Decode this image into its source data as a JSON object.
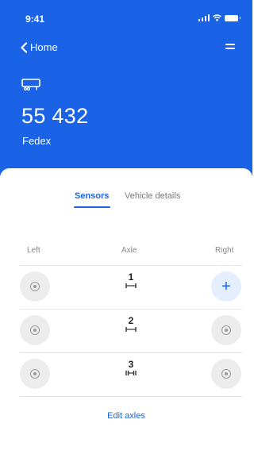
{
  "status_bar": {
    "time": "9:41",
    "icons": [
      "signal-icon",
      "wifi-icon",
      "battery-icon"
    ]
  },
  "nav": {
    "back_label": "Home",
    "back_icon": "chevron-left-icon",
    "menu_icon": "menu-icon"
  },
  "vehicle": {
    "icon": "truck-icon",
    "number": "55 432",
    "company": "Fedex"
  },
  "tabs": [
    {
      "label": "Sensors",
      "active": true
    },
    {
      "label": "Vehicle details",
      "active": false
    }
  ],
  "columns": {
    "left": "Left",
    "axle": "Axle",
    "right": "Right"
  },
  "axles": [
    {
      "number": "1",
      "left": "sensor-icon",
      "right": "add-icon"
    },
    {
      "number": "2",
      "left": "sensor-icon",
      "right": "sensor-icon"
    },
    {
      "number": "3",
      "left": "sensor-icon",
      "right": "sensor-icon"
    }
  ],
  "actions": {
    "edit_axles": "Edit axles"
  },
  "colors": {
    "primary": "#1a63e6",
    "sensor_bg": "#ececec",
    "add_bg": "#e4eefe"
  }
}
